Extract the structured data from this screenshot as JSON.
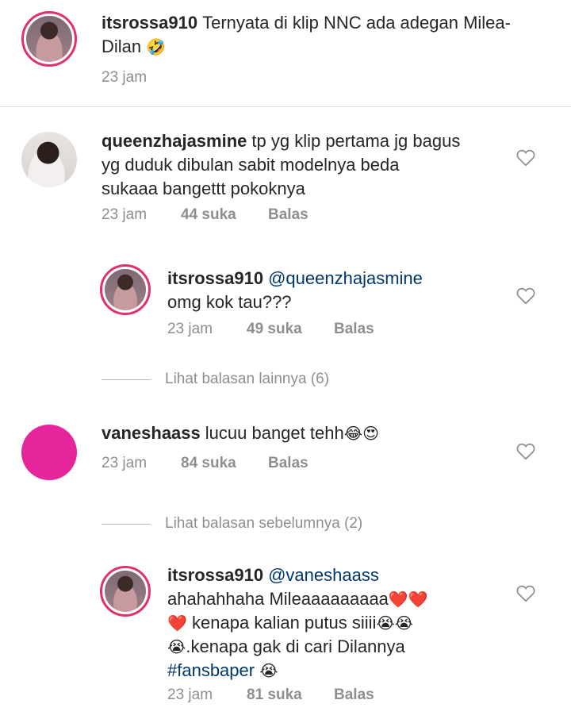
{
  "caption": {
    "username": "itsrossa910",
    "text": "Ternyata di klip NNC ada adegan Milea-Dilan",
    "emoji": "🤣",
    "time": "23 jam"
  },
  "comments": [
    {
      "username": "queenzhajasmine",
      "text_line1": "tp yg klip pertama jg bagus",
      "text_line2": "yg duduk dibulan sabit modelnya beda",
      "text_line3": "sukaaa bangettt pokoknya",
      "time": "23 jam",
      "likes": "44 suka",
      "reply_label": "Balas"
    },
    {
      "username": "itsrossa910",
      "mention": "@queenzhajasmine",
      "text_line1": "omg kok tau???",
      "time": "23 jam",
      "likes": "49 suka",
      "reply_label": "Balas"
    },
    {
      "view_more": "Lihat balasan lainnya (6)"
    },
    {
      "username": "vaneshaass",
      "text_line1": "lucuu banget tehh",
      "emoji": "😂😍",
      "time": "23 jam",
      "likes": "84 suka",
      "reply_label": "Balas"
    },
    {
      "view_previous": "Lihat balasan sebelumnya (2)"
    },
    {
      "username": "itsrossa910",
      "mention": "@vaneshaass",
      "text_line1": "ahahahhaha Mileaaaaaaaaa",
      "emoji1": "❤️❤️",
      "emoji2": "❤️",
      "text_line2": "kenapa kalian putus siiii",
      "emoji3": "😭😭",
      "emoji4": "😭",
      "text_line3": ".kenapa gak di cari Dilannya",
      "hashtag": "#fansbaper",
      "emoji5": "😭",
      "time": "23 jam",
      "likes": "81 suka",
      "reply_label": "Balas"
    }
  ],
  "colors": {
    "mention": "#00376b",
    "meta": "#8e8e8e",
    "story_ring": "#e1306c",
    "vanesha_avatar": "#e5259a"
  },
  "icons": {
    "like": "heart-outline-icon"
  }
}
